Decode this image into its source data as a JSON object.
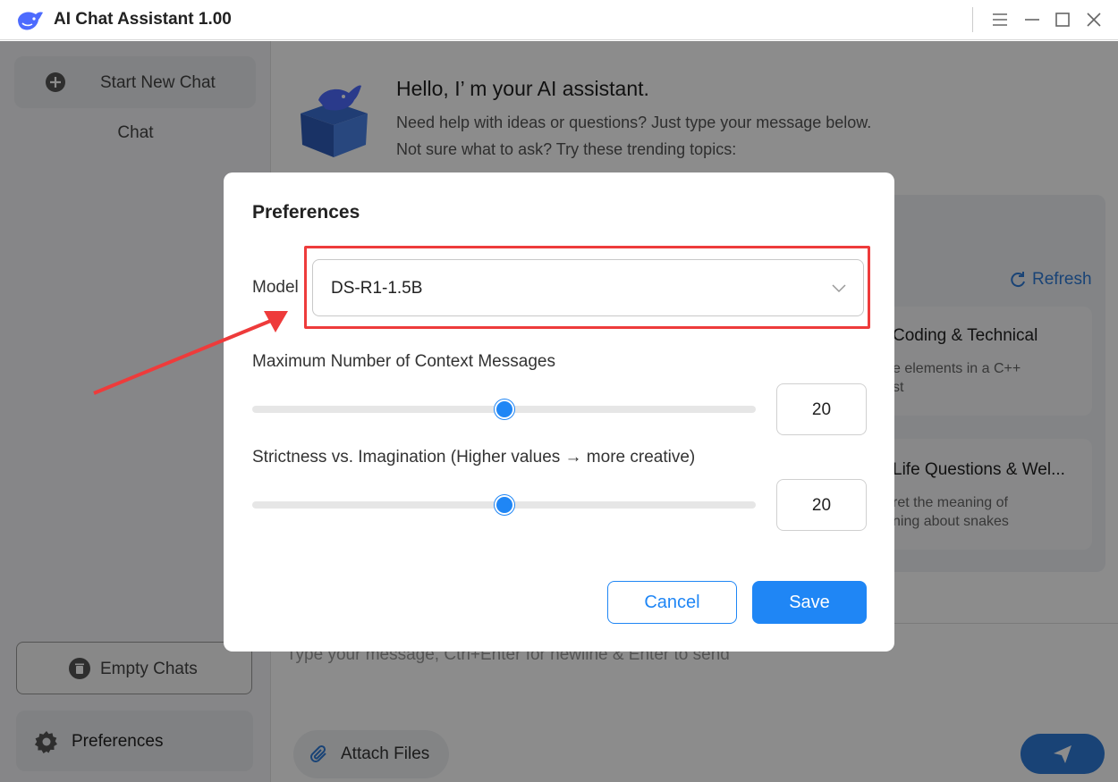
{
  "app": {
    "title": "AI Chat Assistant  1.00"
  },
  "sidebar": {
    "new_chat_label": "Start New Chat",
    "chat_label": "Chat",
    "empty_chats_label": "Empty Chats",
    "preferences_label": "Preferences"
  },
  "main": {
    "greeting": "Hello, I’ m your AI assistant.",
    "sub1": "Need help with ideas or questions? Just type your message below.",
    "sub2": "Not sure what to ask? Try these trending topics:",
    "refresh_label": "Refresh",
    "topics": [
      {
        "title": "Coding & Technical",
        "text1": "e elements in a C++",
        "text2": "st"
      },
      {
        "title": "Life Questions & Wel...",
        "text1": "ret the meaning of",
        "text2": "ning about snakes"
      }
    ],
    "composer_placeholder": "Type your message, Ctrl+Enter for newline & Enter to send",
    "attach_label": "Attach Files"
  },
  "dialog": {
    "title": "Preferences",
    "model_label": "Model",
    "model_value": "DS-R1-1.5B",
    "context_label": "Maximum Number of Context Messages",
    "context_value": "20",
    "context_slider_fraction": 0.5,
    "creativity_label": "Strictness vs. Imagination (Higher values → more creative)",
    "creativity_value": "20",
    "creativity_slider_fraction": 0.5,
    "cancel_label": "Cancel",
    "save_label": "Save"
  },
  "colors": {
    "accent": "#1f86f5",
    "highlight": "#ee3b3b",
    "overlay": "rgba(0,0,0,0.45)"
  }
}
